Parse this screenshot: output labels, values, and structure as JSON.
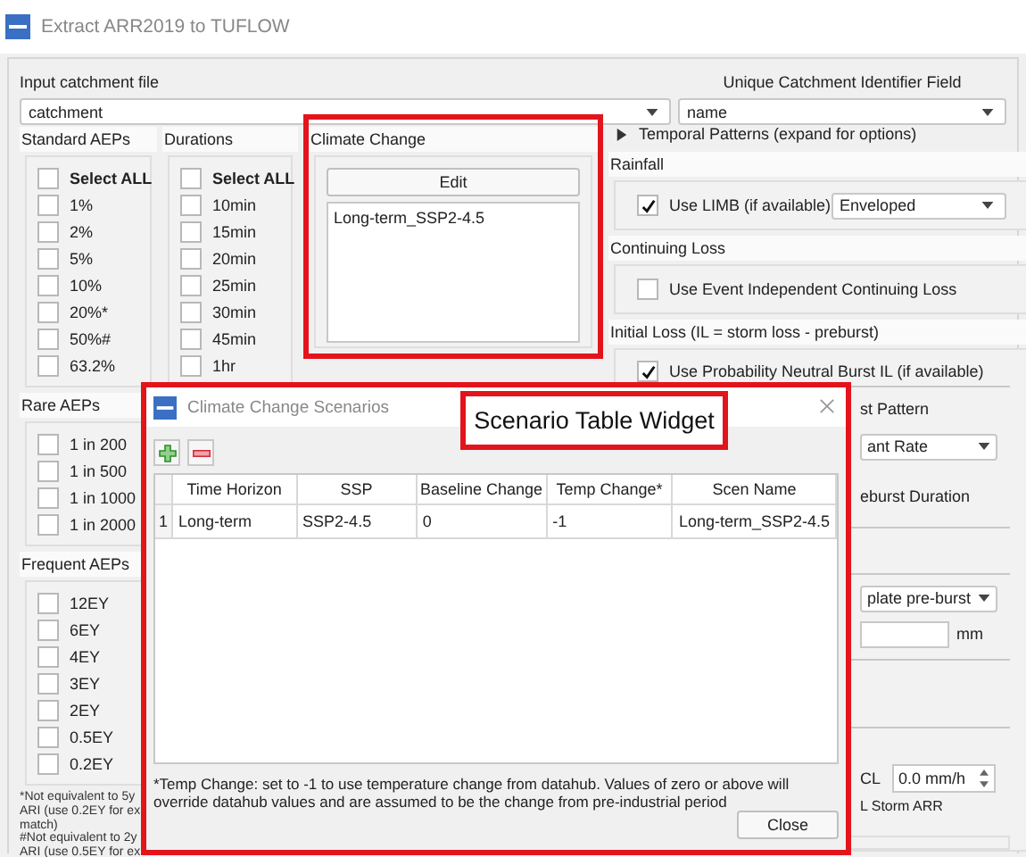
{
  "window": {
    "title": "Extract ARR2019 to TUFLOW"
  },
  "catchment_file": {
    "label": "Input catchment file",
    "value": "catchment"
  },
  "identifier_field": {
    "label": "Unique Catchment Identifier Field",
    "value": "name"
  },
  "standard_aeps": {
    "title": "Standard AEPs",
    "items": [
      {
        "kind": "select_all",
        "label": "Select ALL",
        "checked": false
      },
      {
        "kind": "option",
        "label": "1%",
        "checked": false
      },
      {
        "kind": "option",
        "label": "2%",
        "checked": false
      },
      {
        "kind": "option",
        "label": "5%",
        "checked": false
      },
      {
        "kind": "option",
        "label": "10%",
        "checked": false
      },
      {
        "kind": "option",
        "label": "20%*",
        "checked": false
      },
      {
        "kind": "option",
        "label": "50%#",
        "checked": false
      },
      {
        "kind": "option",
        "label": "63.2%",
        "checked": false
      }
    ]
  },
  "durations": {
    "title": "Durations",
    "items": [
      {
        "kind": "select_all",
        "label": "Select ALL",
        "checked": false
      },
      {
        "kind": "option",
        "label": "10min",
        "checked": false
      },
      {
        "kind": "option",
        "label": "15min",
        "checked": false
      },
      {
        "kind": "option",
        "label": "20min",
        "checked": false
      },
      {
        "kind": "option",
        "label": "25min",
        "checked": false
      },
      {
        "kind": "option",
        "label": "30min",
        "checked": false
      },
      {
        "kind": "option",
        "label": "45min",
        "checked": false
      },
      {
        "kind": "option",
        "label": "1hr",
        "checked": false
      }
    ]
  },
  "climate_change": {
    "title": "Climate Change",
    "edit_button": "Edit",
    "scenarios": [
      "Long-term_SSP2-4.5"
    ]
  },
  "rare_aeps": {
    "title": "Rare AEPs",
    "items": [
      {
        "label": "1 in 200",
        "checked": false
      },
      {
        "label": "1 in 500",
        "checked": false
      },
      {
        "label": "1 in 1000",
        "checked": false
      },
      {
        "label": "1 in 2000",
        "checked": false
      }
    ]
  },
  "frequent_aeps": {
    "title": "Frequent AEPs",
    "items": [
      {
        "label": "12EY",
        "checked": false
      },
      {
        "label": "6EY",
        "checked": false
      },
      {
        "label": "4EY",
        "checked": false
      },
      {
        "label": "3EY",
        "checked": false
      },
      {
        "label": "2EY",
        "checked": false
      },
      {
        "label": "0.5EY",
        "checked": false
      },
      {
        "label": "0.2EY",
        "checked": false
      }
    ]
  },
  "footnotes": [
    "*Not equivalent to 5y",
    "ARI (use 0.2EY for ex",
    "match)",
    "#Not equivalent to 2y",
    "ARI (use 0.5EY for ex"
  ],
  "temporal_patterns": {
    "label": "Temporal Patterns (expand for options)",
    "expanded": false
  },
  "rainfall": {
    "title": "Rainfall",
    "limb": {
      "label": "Use LIMB (if available)",
      "checked": true
    },
    "method": "Enveloped"
  },
  "continuing_loss": {
    "title": "Continuing Loss",
    "option": {
      "label": "Use Event Independent Continuing Loss",
      "checked": false
    }
  },
  "initial_loss": {
    "title": "Initial Loss (IL = storm loss - preburst)",
    "option": {
      "label": "Use Probability Neutral Burst IL (if available)",
      "checked": true
    },
    "pattern_label": "st Pattern",
    "pattern_value": "ant Rate",
    "duration_label": "eburst Duration",
    "preburst_method": "plate pre-burst",
    "unit": "mm",
    "cl_label": "CL",
    "cl_value": "0.0 mm/h",
    "storm_label": "L Storm ARR"
  },
  "dialog": {
    "title": "Climate Change Scenarios",
    "annotation": "Scenario Table Widget",
    "table": {
      "columns": [
        "Time Horizon",
        "SSP",
        "Baseline Change",
        "Temp Change*",
        "Scen Name"
      ],
      "rows": [
        {
          "index": "1",
          "cells": [
            "Long-term",
            "SSP2-4.5",
            "0",
            "-1",
            "Long-term_SSP2-4.5"
          ]
        }
      ]
    },
    "note": "*Temp Change: set to -1 to use temperature change from datahub. Values of zero or above will override datahub values and are assumed to be the change from pre-industrial period",
    "close_button": "Close"
  }
}
